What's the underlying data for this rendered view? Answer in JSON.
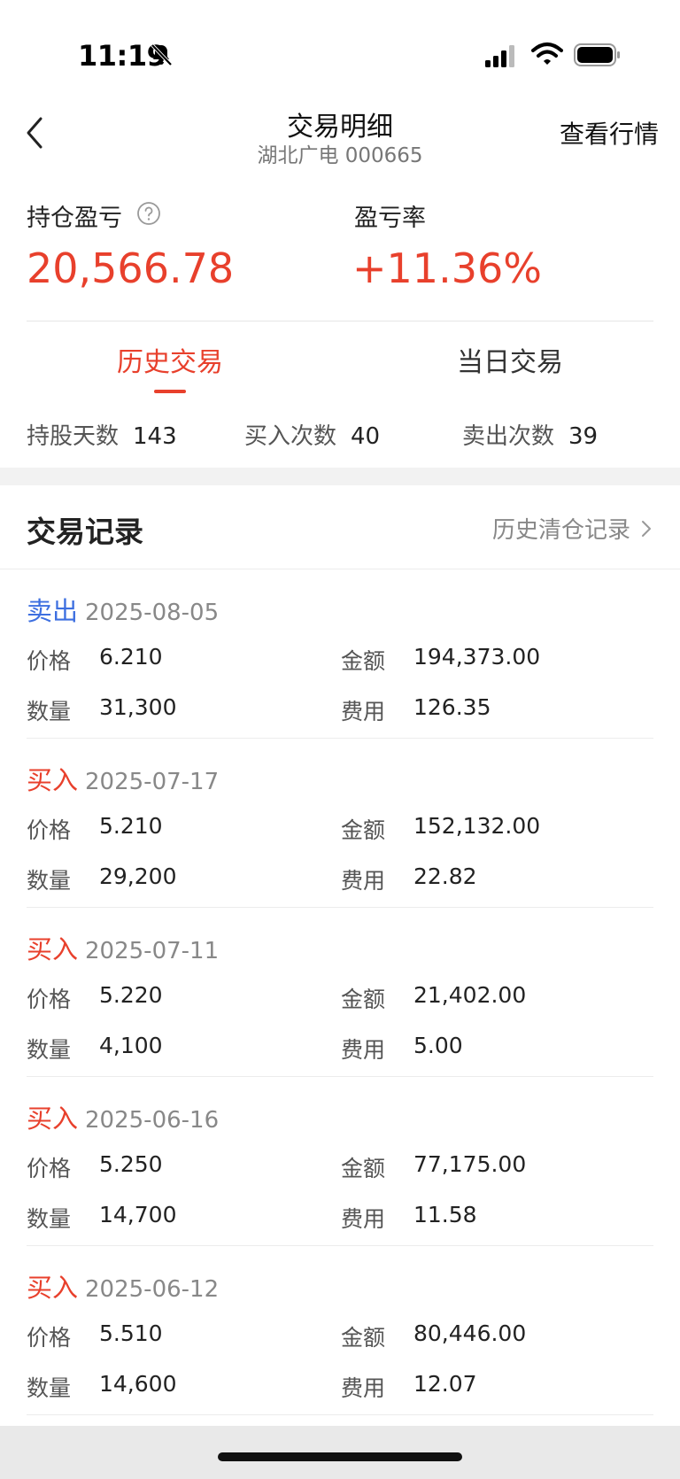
{
  "status_bar": {
    "time": "11:19",
    "icons": [
      "bell-slash-icon",
      "signal-icon",
      "wifi-icon",
      "battery-icon"
    ]
  },
  "nav": {
    "title": "交易明细",
    "subtitle": "湖北广电  000665",
    "action_label": "查看行情"
  },
  "summary": {
    "pnl_label": "持仓盈亏",
    "pnl_value": "20,566.78",
    "rate_label": "盈亏率",
    "rate_value": "+11.36%"
  },
  "tabs": [
    {
      "label": "历史交易",
      "active": true
    },
    {
      "label": "当日交易",
      "active": false
    }
  ],
  "stats": {
    "days_label": "持股天数",
    "days_value": "143",
    "buy_label": "买入次数",
    "buy_value": "40",
    "sell_label": "卖出次数",
    "sell_value": "39"
  },
  "records": {
    "title": "交易记录",
    "history_link": "历史清仓记录",
    "field_labels": {
      "price": "价格",
      "amount": "金额",
      "qty": "数量",
      "fee": "费用"
    },
    "items": [
      {
        "type": "卖出",
        "side": "sell",
        "date": "2025-08-05",
        "price": "6.210",
        "amount": "194,373.00",
        "qty": "31,300",
        "fee": "126.35"
      },
      {
        "type": "买入",
        "side": "buy",
        "date": "2025-07-17",
        "price": "5.210",
        "amount": "152,132.00",
        "qty": "29,200",
        "fee": "22.82"
      },
      {
        "type": "买入",
        "side": "buy",
        "date": "2025-07-11",
        "price": "5.220",
        "amount": "21,402.00",
        "qty": "4,100",
        "fee": "5.00"
      },
      {
        "type": "买入",
        "side": "buy",
        "date": "2025-06-16",
        "price": "5.250",
        "amount": "77,175.00",
        "qty": "14,700",
        "fee": "11.58"
      },
      {
        "type": "买入",
        "side": "buy",
        "date": "2025-06-12",
        "price": "5.510",
        "amount": "80,446.00",
        "qty": "14,600",
        "fee": "12.07"
      }
    ]
  },
  "colors": {
    "profit": "#e8402c",
    "buy": "#e8402c",
    "sell": "#3d6fe0"
  }
}
